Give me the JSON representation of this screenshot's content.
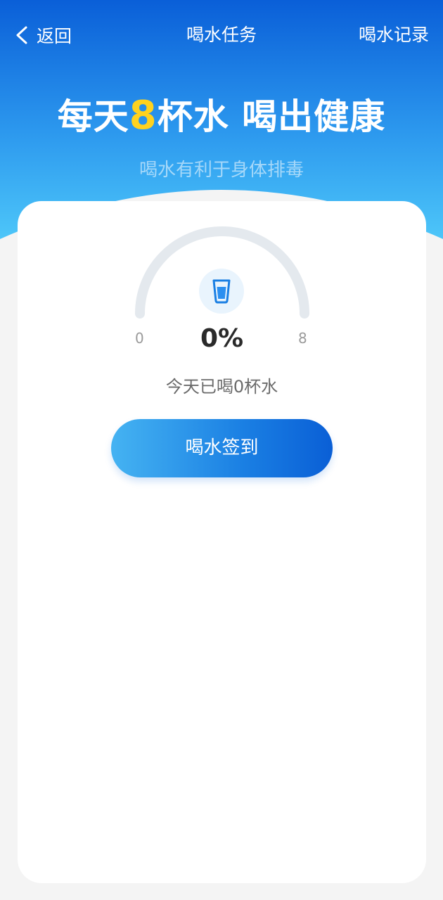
{
  "nav": {
    "back_label": "返回",
    "title": "喝水任务",
    "records_label": "喝水记录"
  },
  "hero": {
    "headline_prefix": "每天",
    "headline_number": "8",
    "headline_suffix": "杯水 喝出健康",
    "subtitle": "喝水有利于身体排毒"
  },
  "progress": {
    "min_label": "0",
    "max_label": "8",
    "percent_label": "0%",
    "value": 0,
    "max": 8,
    "icon": "water-cup-icon"
  },
  "status_text": "今天已喝0杯水",
  "checkin_button_label": "喝水签到",
  "colors": {
    "header_top": "#0a5fd8",
    "header_bottom": "#48c3f8",
    "accent_yellow": "#ffd21f",
    "button_left": "#45b3f2",
    "button_right": "#0a5fd6",
    "gauge_track": "#e4e9ee"
  }
}
